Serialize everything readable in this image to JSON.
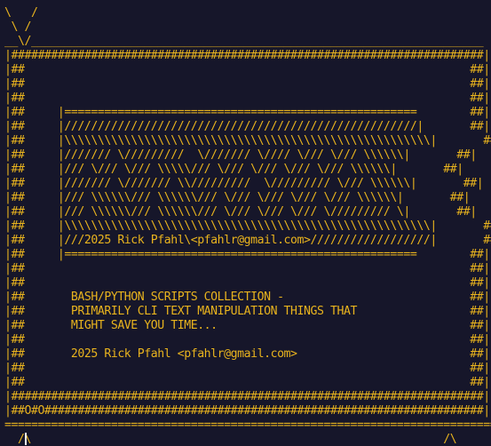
{
  "theme": {
    "background": "#16162a",
    "text_color": "#e8b31e",
    "cursor_color": "#f0f0f0"
  },
  "terminal": {
    "lines": [
      "\\   /",
      " \\ /",
      "__\\/____________________________________________________________________",
      "|#######################################################################|",
      "|##                                                                   ##|",
      "|##                                                                   ##|",
      "|##                                                                   ##|",
      "|##     |=====================================================        ##|",
      "|##     |/////////////////////////////////////////////////////|       ##|",
      "|##     |\\\\\\\\\\\\\\\\\\\\\\\\\\\\\\\\\\\\\\\\\\\\\\\\\\\\\\\\\\\\\\\\\\\\\\\\\\\\\\\\\\\\\\\\\\\\\\\\\\\\\\\\\\\\\\|       ##|",
      "|##     |/////// \\/////////  \\/////// \\//// \\/// \\/// \\\\\\\\\\\\|       ##|",
      "|##     |/// \\/// \\/// \\\\\\\\\\/// \\/// \\/// \\/// \\/// \\\\\\\\\\\\|       ##|",
      "|##     |/////// \\/////// \\\\/////////  \\///////// \\/// \\\\\\\\\\\\|       ##|",
      "|##     |/// \\\\\\\\\\\\/// \\\\\\\\\\\\/// \\/// \\/// \\/// \\/// \\\\\\\\\\\\|       ##|",
      "|##     |/// \\\\\\\\\\\\/// \\\\\\\\\\\\/// \\/// \\/// \\/// \\///////// \\|       ##|",
      "|##     |\\\\\\\\\\\\\\\\\\\\\\\\\\\\\\\\\\\\\\\\\\\\\\\\\\\\\\\\\\\\\\\\\\\\\\\\\\\\\\\\\\\\\\\\\\\\\\\\\\\\\\\\\\\\\\|       ##|",
      "|##     |///2025 Rick Pfahl\\<pfahlr@gmail.com>//////////////////|       ##|",
      "|##     |=====================================================        ##|",
      "|##                                                                   ##|",
      "|##                                                                   ##|",
      "|##       BASH/PYTHON SCRIPTS COLLECTION -                            ##|",
      "|##       PRIMARILY CLI TEXT MANIPULATION THINGS THAT                 ##|",
      "|##       MIGHT SAVE YOU TIME...                                      ##|",
      "|##                                                                   ##|",
      "|##       2025 Rick Pfahl <pfahlr@gmail.com>                          ##|",
      "|##                                                                   ##|",
      "|##                                                                   ##|",
      "|#######################################################################|",
      "|##O#O##################################################################|",
      "==========================================================================",
      "  /\\                                                              /\\"
    ]
  }
}
